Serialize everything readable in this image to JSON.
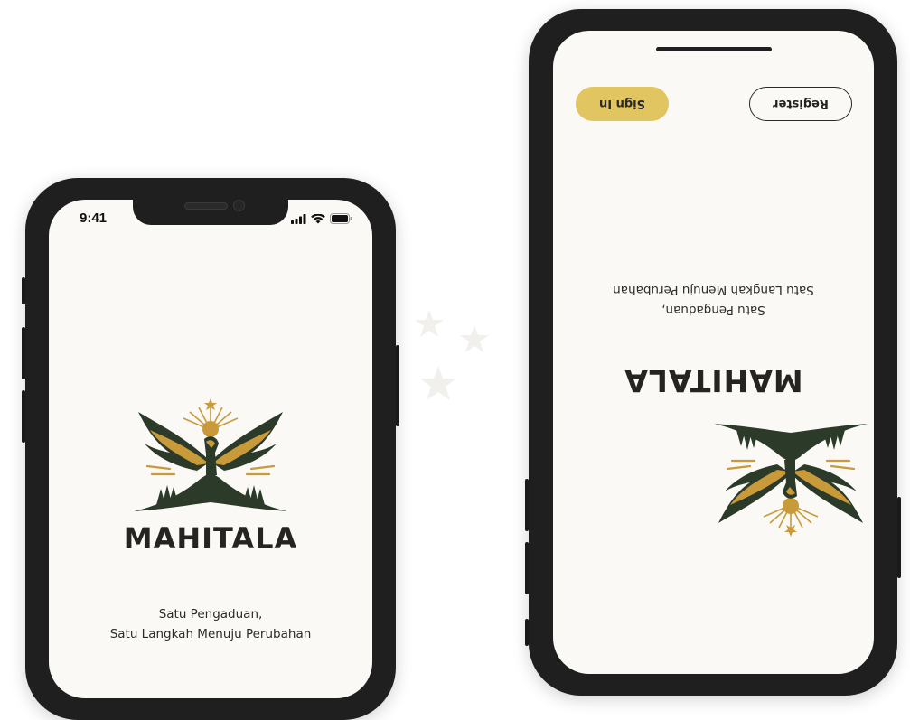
{
  "status_bar": {
    "time": "9:41"
  },
  "app": {
    "brand": "MAHITALA",
    "tagline_line1": "Satu Pengaduan,",
    "tagline_line2": "Satu Langkah Menuju Perubahan"
  },
  "auth": {
    "signin_label": "Sign In",
    "register_label": "Register"
  },
  "icons": [
    "signal-icon",
    "wifi-icon",
    "battery-icon",
    "eagle-logo",
    "star-decoration-icon"
  ],
  "colors": {
    "gold": "#c99a3a",
    "dark_green": "#2c3a2a",
    "signin_yellow": "#e0c560",
    "screen_bg": "#faf9f5"
  }
}
